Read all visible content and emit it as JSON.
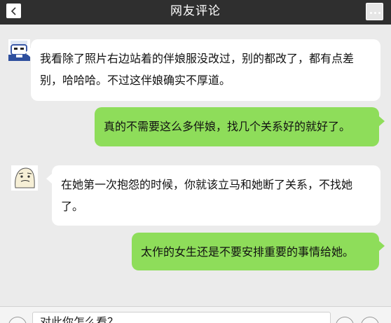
{
  "header": {
    "title": "网友评论",
    "back_icon": "chevron-left-icon",
    "more_icon": "more-dots-icon"
  },
  "messages": [
    {
      "side": "left",
      "avatar": "avatar-badge-character",
      "text": "我看除了照片右边站着的伴娘服没改过，别的都改了，都有点差别，哈哈哈。不过这伴娘确实不厚道。"
    },
    {
      "side": "right",
      "text": "真的不需要这么多伴娘，找几个关系好的就好了。"
    },
    {
      "side": "left",
      "avatar": "avatar-doodle-face",
      "text": "在她第一次抱怨的时候，你就该立马和她断了关系，不找她了。"
    },
    {
      "side": "right",
      "text": "太作的女生还是不要安排重要的事情给她。"
    }
  ],
  "composer": {
    "input_value": "对此你怎么看？",
    "voice_icon": "voice-icon",
    "emoji_icon": "emoji-icon",
    "plus_icon": "plus-icon"
  },
  "colors": {
    "topbar": "#2f2f2f",
    "background": "#ebebeb",
    "bubble_left": "#ffffff",
    "bubble_right": "#8edd5a"
  }
}
